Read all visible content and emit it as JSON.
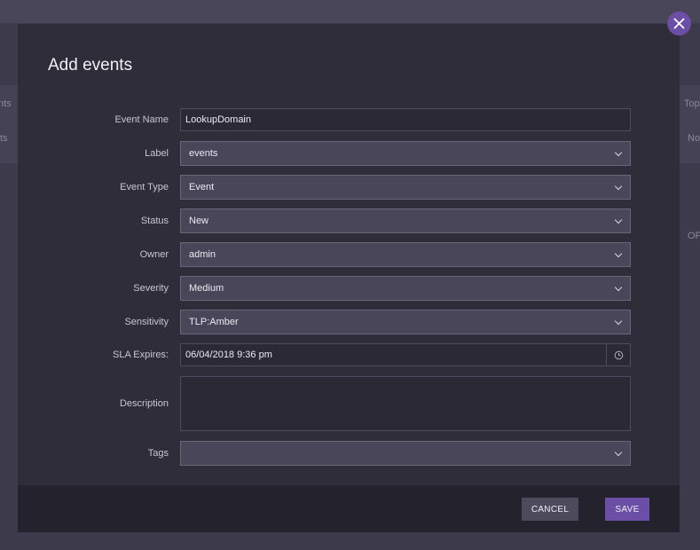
{
  "background": {
    "left_text_1": "nts",
    "left_text_2": "ts",
    "right_text_1": "Top",
    "right_text_2": "No",
    "right_text_3": "OP"
  },
  "modal": {
    "title": "Add events",
    "fields": {
      "event_name": {
        "label": "Event Name",
        "value": "LookupDomain"
      },
      "label": {
        "label": "Label",
        "value": "events"
      },
      "event_type": {
        "label": "Event Type",
        "value": "Event"
      },
      "status": {
        "label": "Status",
        "value": "New"
      },
      "owner": {
        "label": "Owner",
        "value": "admin"
      },
      "severity": {
        "label": "Severity",
        "value": "Medium"
      },
      "sensitivity": {
        "label": "Sensitivity",
        "value": "TLP:Amber"
      },
      "sla_expires": {
        "label": "SLA Expires:",
        "value": "06/04/2018 9:36 pm"
      },
      "description": {
        "label": "Description",
        "value": ""
      },
      "tags": {
        "label": "Tags",
        "value": ""
      }
    },
    "footer": {
      "cancel_label": "CANCEL",
      "save_label": "SAVE"
    }
  },
  "icons": {
    "close": "close-icon",
    "chevron": "chevron-down-icon",
    "clock": "clock-icon"
  },
  "colors": {
    "accent": "#6b4ea6",
    "modal_bg": "#2f2d3a",
    "select_bg": "#4a4659"
  }
}
